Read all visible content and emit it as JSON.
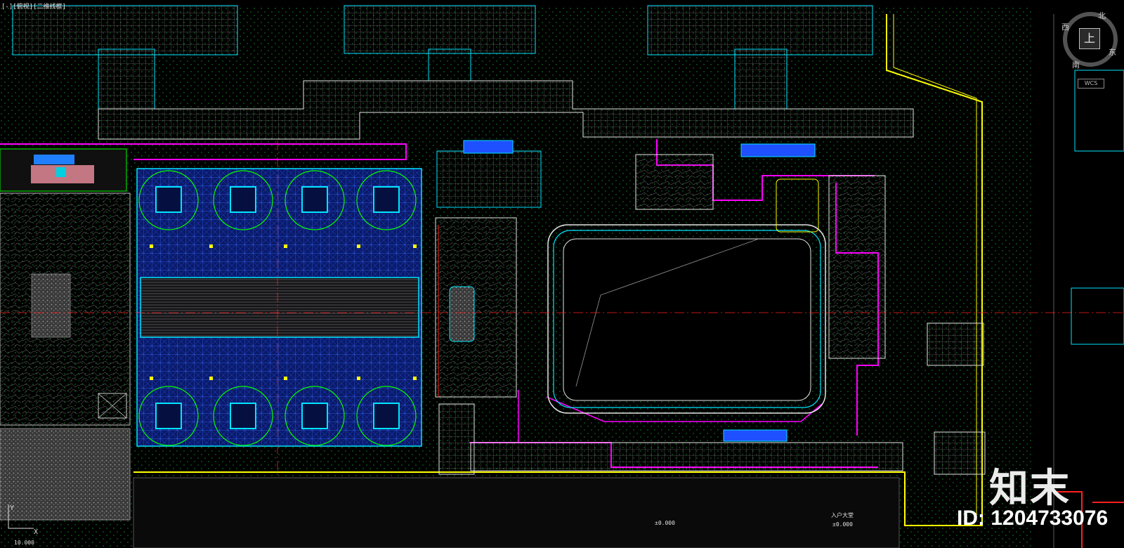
{
  "viewport": {
    "label": "[-][俯视][二维线框]"
  },
  "viewcube": {
    "north": "北",
    "south": "南",
    "east": "东",
    "west": "西",
    "top": "上",
    "wcs": "WCS"
  },
  "annotations": {
    "elevation_left": "±0.000",
    "elevation_right": "±0.000",
    "entrance_label": "入户大堂",
    "bottom_dim": "10.000"
  },
  "ucs": {
    "x": "X",
    "y": "Y"
  },
  "watermark": {
    "logo": "知末",
    "id": "ID: 1204733076"
  },
  "colors": {
    "background": "#000000",
    "cyan": "#00e5ff",
    "magenta": "#ff00ff",
    "yellow": "#ffff00",
    "green": "#00ff00",
    "blue": "#1e50ff",
    "red": "#ff2020",
    "white": "#e6e6e6",
    "gray": "#808080"
  }
}
